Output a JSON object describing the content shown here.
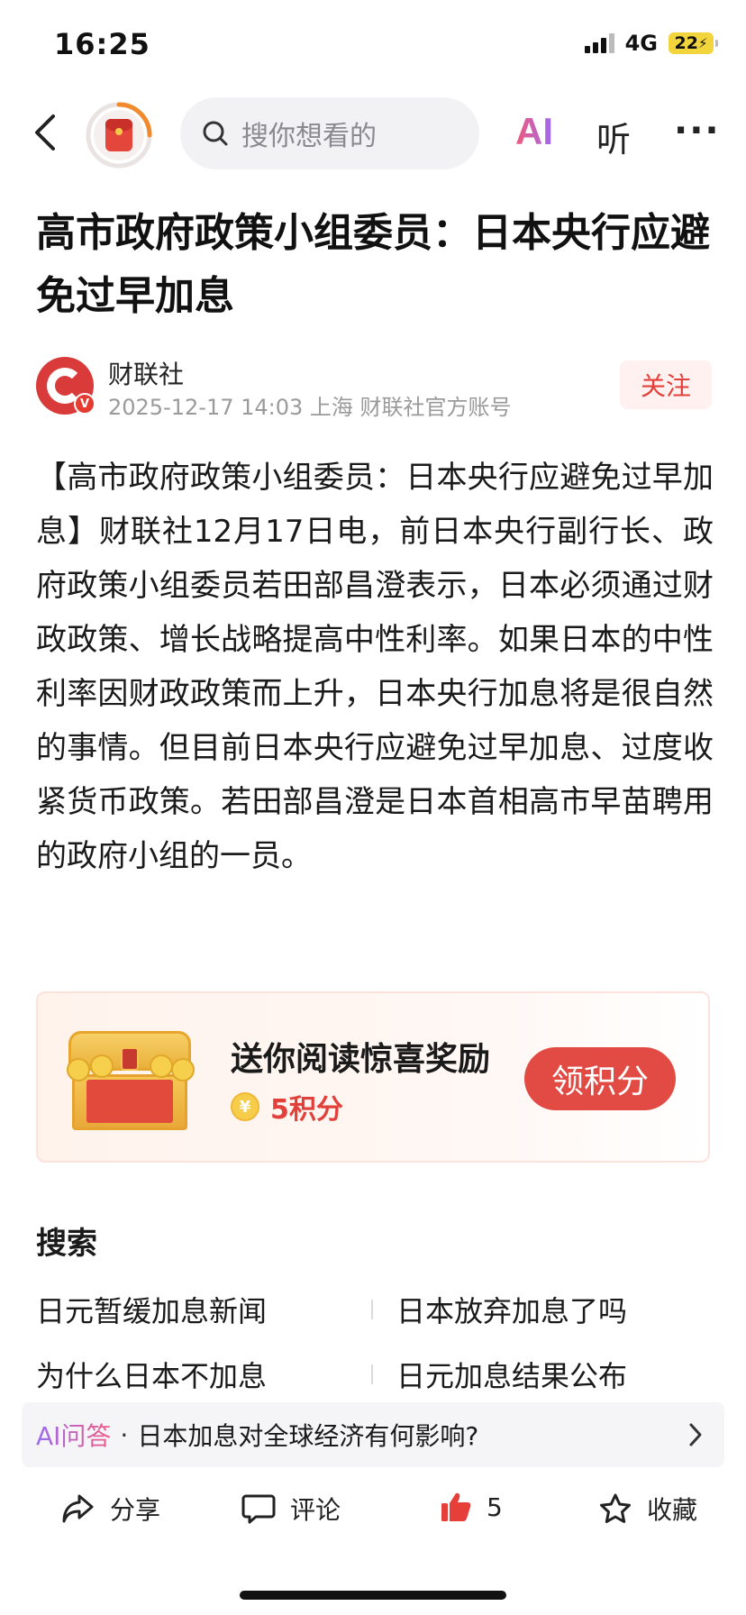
{
  "status_bar": {
    "time": "16:25",
    "network": "4G",
    "battery": "22"
  },
  "nav": {
    "search_placeholder": "搜你想看的",
    "ai_label": "AI",
    "listen_label": "听",
    "more_label": "···"
  },
  "article": {
    "title": "高市政府政策小组委员：日本央行应避免过早加息",
    "author": "财联社",
    "meta": "2025-12-17  14:03  上海  财联社官方账号",
    "follow_label": "关注",
    "verified_mark": "V",
    "body": "【高市政府政策小组委员：日本央行应避免过早加息】财联社12月17日电，前日本央行副行长、政府政策小组委员若田部昌澄表示，日本必须通过财政政策、增长战略提高中性利率。如果日本的中性利率因财政政策而上升，日本央行加息将是很自然的事情。但目前日本央行应避免过早加息、过度收紧货币政策。若田部昌澄是日本首相高市早苗聘用的政府小组的一员。"
  },
  "reward": {
    "title": "送你阅读惊喜奖励",
    "coin_symbol": "¥",
    "points": "5积分",
    "claim_label": "领积分"
  },
  "search": {
    "heading": "搜索",
    "items": [
      "日元暂缓加息新闻",
      "日本放弃加息了吗",
      "为什么日本不加息",
      "日元加息结果公布"
    ]
  },
  "ai_question": {
    "label": "AI问答",
    "separator": "·",
    "question": "日本加息对全球经济有何影响?"
  },
  "bottom_bar": {
    "share_label": "分享",
    "comment_label": "评论",
    "like_count": "5",
    "collect_label": "收藏"
  },
  "colors": {
    "accent": "#e2403a",
    "follow_bg": "#fff1f0",
    "battery": "#f2d43c"
  }
}
